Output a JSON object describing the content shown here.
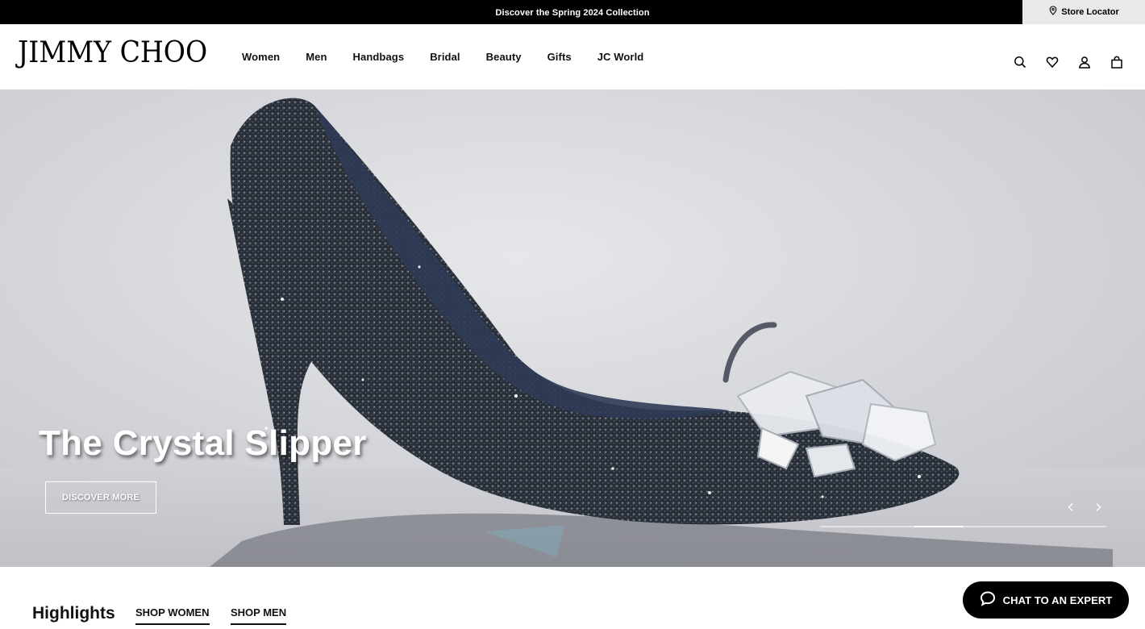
{
  "promo": {
    "text": "Discover the Spring 2024 Collection"
  },
  "store_locator": {
    "label": "Store Locator",
    "icon": "location-pin-icon"
  },
  "brand": {
    "logo_text": "JIMMY CHOO"
  },
  "nav": {
    "items": [
      {
        "label": "Women"
      },
      {
        "label": "Men"
      },
      {
        "label": "Handbags"
      },
      {
        "label": "Bridal"
      },
      {
        "label": "Beauty"
      },
      {
        "label": "Gifts"
      },
      {
        "label": "JC World"
      }
    ]
  },
  "header_icons": [
    "search-icon",
    "heart-icon",
    "user-icon",
    "bag-icon"
  ],
  "hero": {
    "title": "The Crystal Slipper",
    "cta_label": "DISCOVER MORE",
    "carousel_progress": 0.17,
    "carousel_progress_start": 0.33
  },
  "highlights": {
    "title": "Highlights",
    "tabs": [
      {
        "label": "SHOP WOMEN"
      },
      {
        "label": "SHOP MEN"
      }
    ]
  },
  "chat": {
    "label": "CHAT TO AN EXPERT",
    "icon": "chat-bubble-icon"
  },
  "colors": {
    "accent": "#000000",
    "promo_bg": "#000000",
    "locator_bg": "#e9e9e9"
  }
}
